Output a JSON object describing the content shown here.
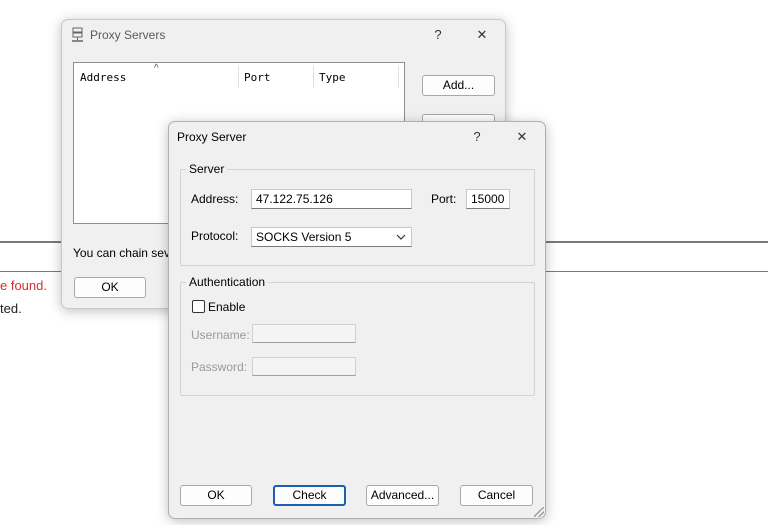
{
  "background": {
    "error_fragment": "e found.",
    "message_fragment": "ted."
  },
  "proxy_servers": {
    "title": "Proxy Servers",
    "help": "?",
    "close": "✕",
    "columns": [
      "Address",
      "Port",
      "Type"
    ],
    "sort_indicator": "^",
    "add_label": "Add...",
    "chain_text": "You can chain sever",
    "ok_label": "OK"
  },
  "proxy_server": {
    "title": "Proxy Server",
    "help": "?",
    "close": "✕",
    "server_group": "Server",
    "address_label": "Address:",
    "address_value": "47.122.75.126",
    "port_label": "Port:",
    "port_value": "15000",
    "protocol_label": "Protocol:",
    "protocol_value": "SOCKS Version 5",
    "auth_group": "Authentication",
    "enable_label": "Enable",
    "enable_checked": false,
    "username_label": "Username:",
    "password_label": "Password:",
    "ok_label": "OK",
    "check_label": "Check",
    "advanced_label": "Advanced...",
    "cancel_label": "Cancel"
  }
}
